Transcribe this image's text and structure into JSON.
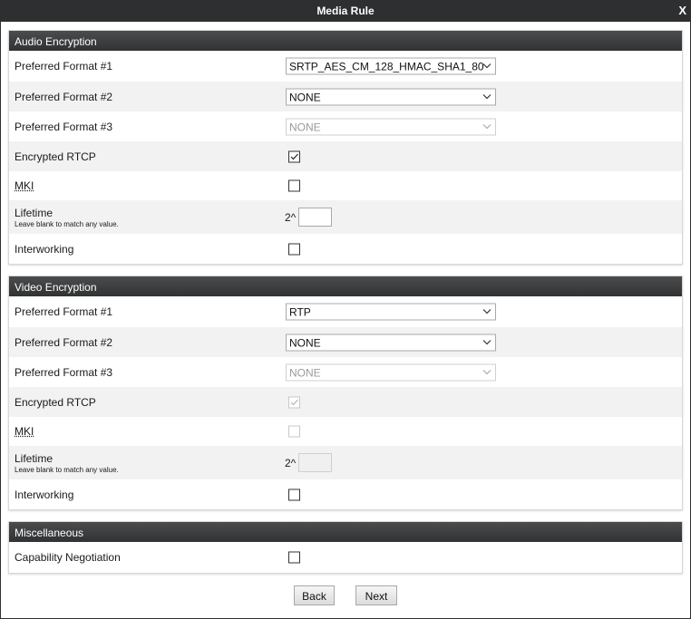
{
  "window": {
    "title": "Media Rule",
    "close_label": "X"
  },
  "audio": {
    "header": "Audio Encryption",
    "pf1_label": "Preferred Format #1",
    "pf1_value": "SRTP_AES_CM_128_HMAC_SHA1_80",
    "pf2_label": "Preferred Format #2",
    "pf2_value": "NONE",
    "pf3_label": "Preferred Format #3",
    "pf3_value": "NONE",
    "rtcp_label": "Encrypted RTCP",
    "rtcp_checked": true,
    "mki_label": "MKI",
    "mki_checked": false,
    "lifetime_label": "Lifetime",
    "lifetime_hint": "Leave blank to match any value.",
    "lifetime_prefix": "2^",
    "lifetime_value": "",
    "interworking_label": "Interworking",
    "interworking_checked": false
  },
  "video": {
    "header": "Video Encryption",
    "pf1_label": "Preferred Format #1",
    "pf1_value": "RTP",
    "pf2_label": "Preferred Format #2",
    "pf2_value": "NONE",
    "pf3_label": "Preferred Format #3",
    "pf3_value": "NONE",
    "rtcp_label": "Encrypted RTCP",
    "rtcp_checked": true,
    "mki_label": "MKI",
    "mki_checked": false,
    "lifetime_label": "Lifetime",
    "lifetime_hint": "Leave blank to match any value.",
    "lifetime_prefix": "2^",
    "lifetime_value": "",
    "interworking_label": "Interworking",
    "interworking_checked": false
  },
  "misc": {
    "header": "Miscellaneous",
    "capneg_label": "Capability Negotiation",
    "capneg_checked": false
  },
  "buttons": {
    "back": "Back",
    "next": "Next"
  }
}
